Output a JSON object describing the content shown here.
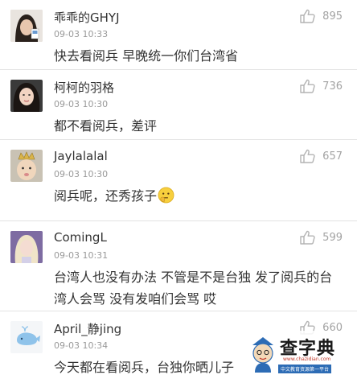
{
  "comments": [
    {
      "username": "乖乖的GHYJ",
      "time": "09-03 10:33",
      "text": "快去看阅兵 早晚统一你们台湾省",
      "likes": "895",
      "avatar": "avatar-photo-dark-hair"
    },
    {
      "username": "柯柯的羽格",
      "time": "09-03 10:30",
      "text": "都不看阅兵，差评",
      "likes": "736",
      "avatar": "avatar-photo-girl"
    },
    {
      "username": "Jaylalalal",
      "time": "09-03 10:30",
      "text": "阅兵呢，还秀孩子",
      "likes": "657",
      "avatar": "avatar-photo-baby-crown",
      "emoji": "thinking-emoji"
    },
    {
      "username": "ComingL",
      "time": "09-03 10:31",
      "text": "台湾人也没有办法 不管是不是台独 发了阅兵的台湾人会骂 没有发咱们会骂 哎",
      "likes": "599",
      "avatar": "avatar-photo-blonde"
    },
    {
      "username": "April_静jing",
      "time": "09-03 10:34",
      "text": "今天都在看阅兵，台独你晒儿子",
      "likes": "660",
      "avatar": "avatar-whale-cartoon"
    }
  ],
  "watermark": {
    "title": "查字典",
    "url": "www.chazidian.com",
    "tagline": "中文教育资源第一平台"
  },
  "colors": {
    "text": "#333333",
    "meta": "#999999",
    "like_icon": "#b3b3b3",
    "divider": "#e3e3e3",
    "watermark_blue": "#2d6cb5"
  }
}
